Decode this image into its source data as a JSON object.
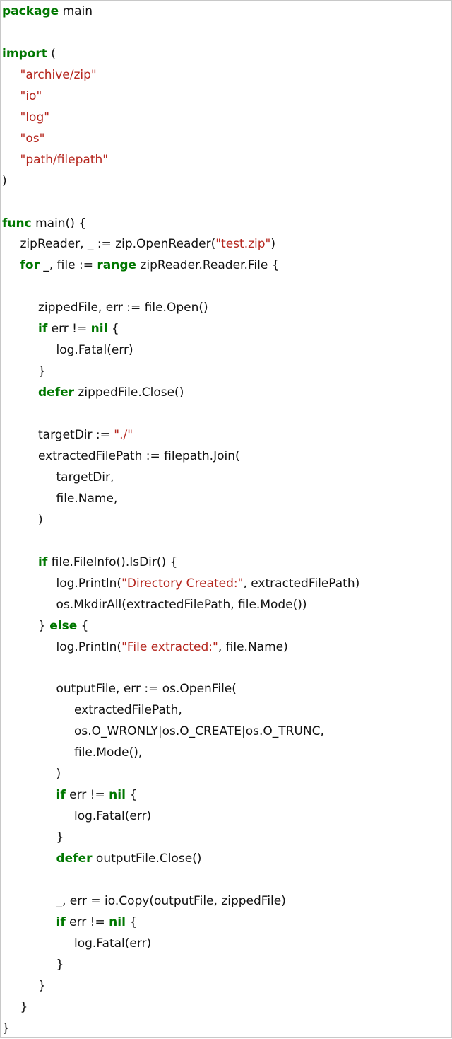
{
  "colors": {
    "keyword": "#007700",
    "string": "#b5261e",
    "text": "#111111",
    "background": "#ffffff",
    "border": "#c8c8c8"
  },
  "code": {
    "lines": [
      {
        "indent": 0,
        "tokens": [
          [
            "kw",
            "package"
          ],
          [
            "t",
            " main"
          ]
        ]
      },
      {
        "indent": 0,
        "tokens": []
      },
      {
        "indent": 0,
        "tokens": [
          [
            "kw",
            "import"
          ],
          [
            "t",
            " ("
          ]
        ]
      },
      {
        "indent": 1,
        "tokens": [
          [
            "str",
            "\"archive/zip\""
          ]
        ]
      },
      {
        "indent": 1,
        "tokens": [
          [
            "str",
            "\"io\""
          ]
        ]
      },
      {
        "indent": 1,
        "tokens": [
          [
            "str",
            "\"log\""
          ]
        ]
      },
      {
        "indent": 1,
        "tokens": [
          [
            "str",
            "\"os\""
          ]
        ]
      },
      {
        "indent": 1,
        "tokens": [
          [
            "str",
            "\"path/filepath\""
          ]
        ]
      },
      {
        "indent": 0,
        "tokens": [
          [
            "t",
            ")"
          ]
        ]
      },
      {
        "indent": 0,
        "tokens": []
      },
      {
        "indent": 0,
        "tokens": [
          [
            "kw",
            "func"
          ],
          [
            "t",
            " main() {"
          ]
        ]
      },
      {
        "indent": 1,
        "tokens": [
          [
            "t",
            "zipReader, _ := zip.OpenReader("
          ],
          [
            "str",
            "\"test.zip\""
          ],
          [
            "t",
            ")"
          ]
        ]
      },
      {
        "indent": 1,
        "tokens": [
          [
            "kw",
            "for"
          ],
          [
            "t",
            " _, file := "
          ],
          [
            "kw",
            "range"
          ],
          [
            "t",
            " zipReader.Reader.File {"
          ]
        ]
      },
      {
        "indent": 0,
        "tokens": []
      },
      {
        "indent": 2,
        "tokens": [
          [
            "t",
            "zippedFile, err := file.Open()"
          ]
        ]
      },
      {
        "indent": 2,
        "tokens": [
          [
            "kw",
            "if"
          ],
          [
            "t",
            " err != "
          ],
          [
            "kw",
            "nil"
          ],
          [
            "t",
            " {"
          ]
        ]
      },
      {
        "indent": 3,
        "tokens": [
          [
            "t",
            "log.Fatal(err)"
          ]
        ]
      },
      {
        "indent": 2,
        "tokens": [
          [
            "t",
            "}"
          ]
        ]
      },
      {
        "indent": 2,
        "tokens": [
          [
            "kw",
            "defer"
          ],
          [
            "t",
            " zippedFile.Close()"
          ]
        ]
      },
      {
        "indent": 0,
        "tokens": []
      },
      {
        "indent": 2,
        "tokens": [
          [
            "t",
            "targetDir := "
          ],
          [
            "str",
            "\"./\""
          ]
        ]
      },
      {
        "indent": 2,
        "tokens": [
          [
            "t",
            "extractedFilePath := filepath.Join("
          ]
        ]
      },
      {
        "indent": 3,
        "tokens": [
          [
            "t",
            "targetDir,"
          ]
        ]
      },
      {
        "indent": 3,
        "tokens": [
          [
            "t",
            "file.Name,"
          ]
        ]
      },
      {
        "indent": 2,
        "tokens": [
          [
            "t",
            ")"
          ]
        ]
      },
      {
        "indent": 0,
        "tokens": []
      },
      {
        "indent": 2,
        "tokens": [
          [
            "kw",
            "if"
          ],
          [
            "t",
            " file.FileInfo().IsDir() {"
          ]
        ]
      },
      {
        "indent": 3,
        "tokens": [
          [
            "t",
            "log.Println("
          ],
          [
            "str",
            "\"Directory Created:\""
          ],
          [
            "t",
            ", extractedFilePath)"
          ]
        ]
      },
      {
        "indent": 3,
        "tokens": [
          [
            "t",
            "os.MkdirAll(extractedFilePath, file.Mode())"
          ]
        ]
      },
      {
        "indent": 2,
        "tokens": [
          [
            "t",
            "} "
          ],
          [
            "kw",
            "else"
          ],
          [
            "t",
            " {"
          ]
        ]
      },
      {
        "indent": 3,
        "tokens": [
          [
            "t",
            "log.Println("
          ],
          [
            "str",
            "\"File extracted:\""
          ],
          [
            "t",
            ", file.Name)"
          ]
        ]
      },
      {
        "indent": 0,
        "tokens": []
      },
      {
        "indent": 3,
        "tokens": [
          [
            "t",
            "outputFile, err := os.OpenFile("
          ]
        ]
      },
      {
        "indent": 4,
        "tokens": [
          [
            "t",
            "extractedFilePath,"
          ]
        ]
      },
      {
        "indent": 4,
        "tokens": [
          [
            "t",
            "os.O_WRONLY|os.O_CREATE|os.O_TRUNC,"
          ]
        ]
      },
      {
        "indent": 4,
        "tokens": [
          [
            "t",
            "file.Mode(),"
          ]
        ]
      },
      {
        "indent": 3,
        "tokens": [
          [
            "t",
            ")"
          ]
        ]
      },
      {
        "indent": 3,
        "tokens": [
          [
            "kw",
            "if"
          ],
          [
            "t",
            " err != "
          ],
          [
            "kw",
            "nil"
          ],
          [
            "t",
            " {"
          ]
        ]
      },
      {
        "indent": 4,
        "tokens": [
          [
            "t",
            "log.Fatal(err)"
          ]
        ]
      },
      {
        "indent": 3,
        "tokens": [
          [
            "t",
            "}"
          ]
        ]
      },
      {
        "indent": 3,
        "tokens": [
          [
            "kw",
            "defer"
          ],
          [
            "t",
            " outputFile.Close()"
          ]
        ]
      },
      {
        "indent": 0,
        "tokens": []
      },
      {
        "indent": 3,
        "tokens": [
          [
            "t",
            "_, err = io.Copy(outputFile, zippedFile)"
          ]
        ]
      },
      {
        "indent": 3,
        "tokens": [
          [
            "kw",
            "if"
          ],
          [
            "t",
            " err != "
          ],
          [
            "kw",
            "nil"
          ],
          [
            "t",
            " {"
          ]
        ]
      },
      {
        "indent": 4,
        "tokens": [
          [
            "t",
            "log.Fatal(err)"
          ]
        ]
      },
      {
        "indent": 3,
        "tokens": [
          [
            "t",
            "}"
          ]
        ]
      },
      {
        "indent": 2,
        "tokens": [
          [
            "t",
            "}"
          ]
        ]
      },
      {
        "indent": 1,
        "tokens": [
          [
            "t",
            "}"
          ]
        ]
      },
      {
        "indent": 0,
        "tokens": [
          [
            "t",
            "}"
          ]
        ]
      }
    ]
  }
}
